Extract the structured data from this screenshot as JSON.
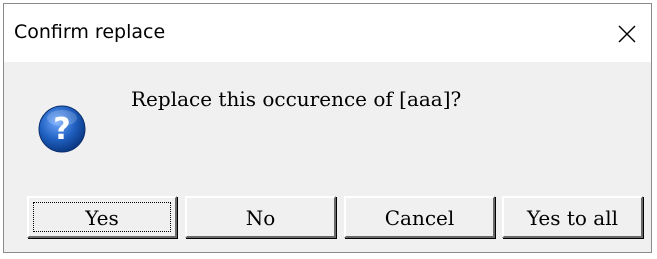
{
  "dialog": {
    "title": "Confirm replace",
    "close_icon": "close-icon",
    "message": "Replace this occurence of [aaa]?",
    "message_icon": "question-icon"
  },
  "buttons": {
    "yes": "Yes",
    "no": "No",
    "cancel": "Cancel",
    "yes_to_all": "Yes to all"
  },
  "colors": {
    "icon_blue": "#1f5fbf",
    "dialog_background": "#f0f0f0",
    "titlebar_background": "#ffffff"
  }
}
